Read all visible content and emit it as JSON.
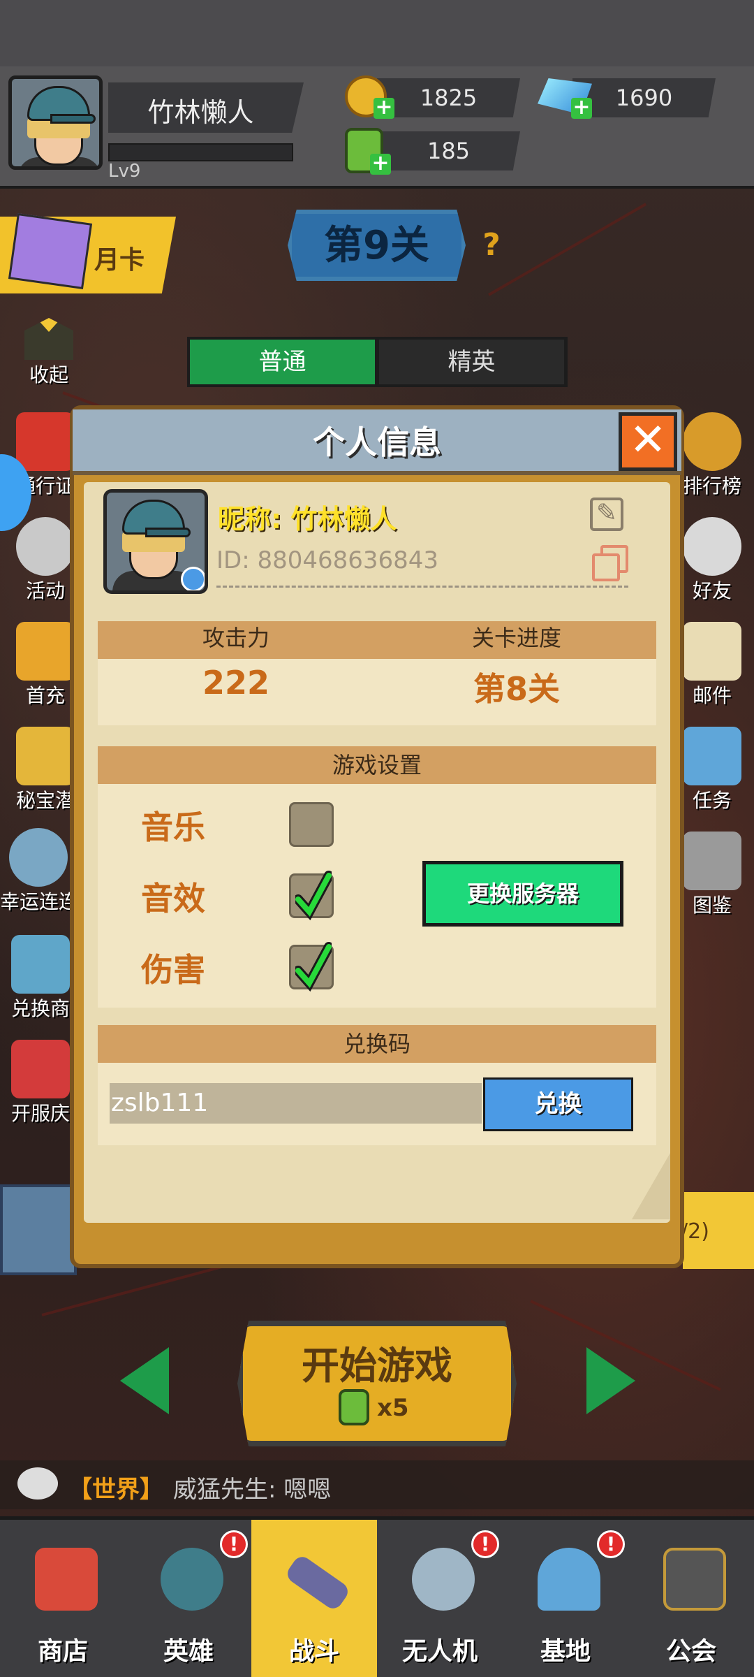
{
  "player": {
    "name": "竹林懒人",
    "level": "Lv9"
  },
  "resources": {
    "gold": "1825",
    "gems": "1690",
    "stamina": "185"
  },
  "month_card": "月卡",
  "stage": {
    "title": "第9关",
    "help": "?"
  },
  "mode_tabs": [
    {
      "label": "普通",
      "active": true
    },
    {
      "label": "精英",
      "active": false
    }
  ],
  "left_menu": [
    "收起",
    "通行证",
    "活动",
    "首充",
    "秘宝潜",
    "幸运连连",
    "兑换商",
    "开服庆"
  ],
  "right_menu": [
    "排行榜",
    "好友",
    "邮件",
    "任务",
    "图鉴"
  ],
  "partial_label": "/2)",
  "dialog": {
    "title": "个人信息",
    "close": "✕",
    "nickname": "昵称: 竹林懒人",
    "id": "ID: 880468636843",
    "stats_header": {
      "attack": "攻击力",
      "progress": "关卡进度"
    },
    "stats_values": {
      "attack": "222",
      "progress": "第8关"
    },
    "settings_title": "游戏设置",
    "settings": [
      {
        "label": "音乐",
        "checked": false
      },
      {
        "label": "音效",
        "checked": true
      },
      {
        "label": "伤害",
        "checked": true
      }
    ],
    "change_server": "更换服务器",
    "redeem_title": "兑换码",
    "redeem_value": "zslb111",
    "redeem_button": "兑换"
  },
  "start": {
    "label": "开始游戏",
    "cost": "x5"
  },
  "chat": {
    "channel": "【世界】",
    "message": "威猛先生: 嗯嗯"
  },
  "nav": [
    {
      "label": "商店",
      "badge": false,
      "active": false
    },
    {
      "label": "英雄",
      "badge": true,
      "active": false
    },
    {
      "label": "战斗",
      "badge": false,
      "active": true
    },
    {
      "label": "无人机",
      "badge": true,
      "active": false
    },
    {
      "label": "基地",
      "badge": true,
      "active": false
    },
    {
      "label": "公会",
      "badge": false,
      "active": false
    }
  ],
  "badge_mark": "!",
  "colors": {
    "accent_green": "#1ed97b",
    "accent_blue": "#4b9ae5",
    "close_orange": "#f26f24",
    "gold_text": "#c96a19",
    "nav_active": "#f2c736"
  }
}
